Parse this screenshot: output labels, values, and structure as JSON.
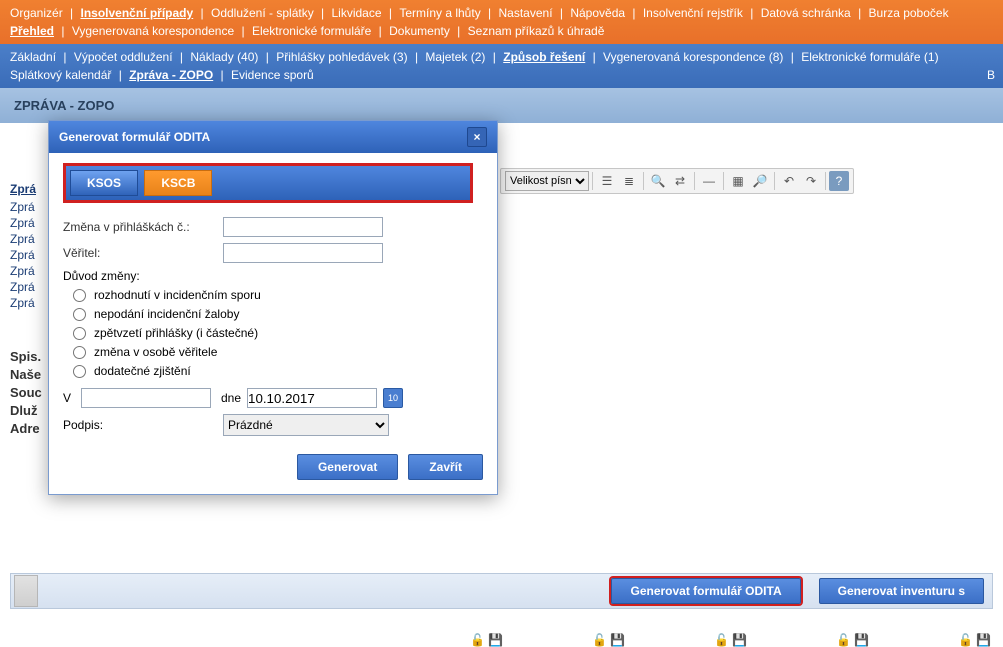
{
  "nav_orange": {
    "row1": [
      "Organizér",
      "Insolvenční případy",
      "Oddlužení - splátky",
      "Likvidace",
      "Termíny a lhůty",
      "Nastavení",
      "Nápověda",
      "Insolvenční rejstřík",
      "Datová schránka",
      "Burza poboček"
    ],
    "row1_active": 1,
    "row2": [
      "Přehled",
      "Vygenerovaná korespondence",
      "Elektronické formuláře",
      "Dokumenty",
      "Seznam příkazů k úhradě"
    ],
    "row2_active": 0
  },
  "nav_blue": {
    "row1": [
      "Základní",
      "Výpočet oddlužení",
      "Náklady (40)",
      "Přihlášky pohledávek (3)",
      "Majetek (2)",
      "Způsob řešení",
      "Vygenerovaná korespondence (8)",
      "Elektronické formuláře (1)"
    ],
    "row1_active": 5,
    "row2": [
      "Splátkový kalendář",
      "Zpráva - ZOPO",
      "Evidence sporů"
    ],
    "row2_active": 1,
    "row2_tail": "B"
  },
  "page_title": "ZPRÁVA - ZOPO",
  "side_list": {
    "header": "Zprá",
    "items": [
      "Zprá",
      "Zprá",
      "Zprá",
      "Zprá",
      "Zprá",
      "Zprá",
      "Zprá"
    ]
  },
  "labels_block": [
    "Spis.",
    "Naše",
    "Souc",
    "Dluž",
    "Adre"
  ],
  "toolbar": {
    "fontsize_label": "Velikost písn",
    "help": "?"
  },
  "modal": {
    "title": "Generovat formulář ODITA",
    "tabs": [
      "KSOS",
      "KSCB"
    ],
    "active_tab": 1,
    "field_change": "Změna v přihláškách č.:",
    "field_creditor": "Věřitel:",
    "reason_label": "Důvod změny:",
    "reasons": [
      "rozhodnutí v incidenčním sporu",
      "nepodání incidenční žaloby",
      "zpětvzetí přihlášky (i částečné)",
      "změna v osobě věřitele",
      "dodatečné zjištění"
    ],
    "place_label": "V",
    "date_label": "dne",
    "date_value": "10.10.2017",
    "cal_day": "10",
    "sign_label": "Podpis:",
    "sign_value": "Prázdné",
    "btn_generate": "Generovat",
    "btn_close": "Zavřít",
    "close_x": "×"
  },
  "bottom": {
    "btn_odita": "Generovat formulář ODITA",
    "btn_inventory": "Generovat inventuru s"
  }
}
